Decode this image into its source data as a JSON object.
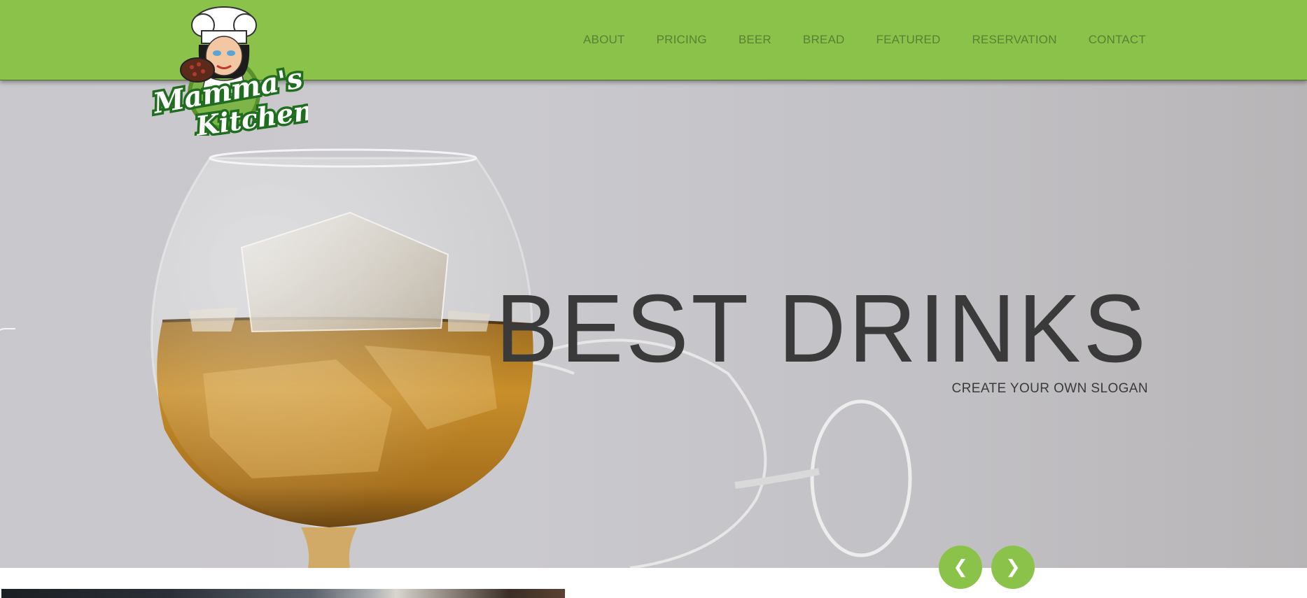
{
  "brand": {
    "logo_text_line1": "Mamma's",
    "logo_text_line2": "Kitchen",
    "colors": {
      "accent": "#8bc34a",
      "nav_text": "#5a7f36",
      "headline": "#3a3a3a"
    }
  },
  "nav": {
    "items": [
      {
        "label": "ABOUT"
      },
      {
        "label": "PRICING"
      },
      {
        "label": "BEER"
      },
      {
        "label": "BREAD"
      },
      {
        "label": "FEATURED"
      },
      {
        "label": "RESERVATION"
      },
      {
        "label": "CONTACT"
      }
    ]
  },
  "hero": {
    "title": "BEST DRINKS",
    "slogan": "CREATE YOUR OWN SLOGAN",
    "image_subject": "glass-of-whiskey-on-ice"
  },
  "slider": {
    "prev_icon": "chevron-left-icon",
    "next_icon": "chevron-right-icon",
    "prev_glyph": "❮",
    "next_glyph": "❯"
  }
}
